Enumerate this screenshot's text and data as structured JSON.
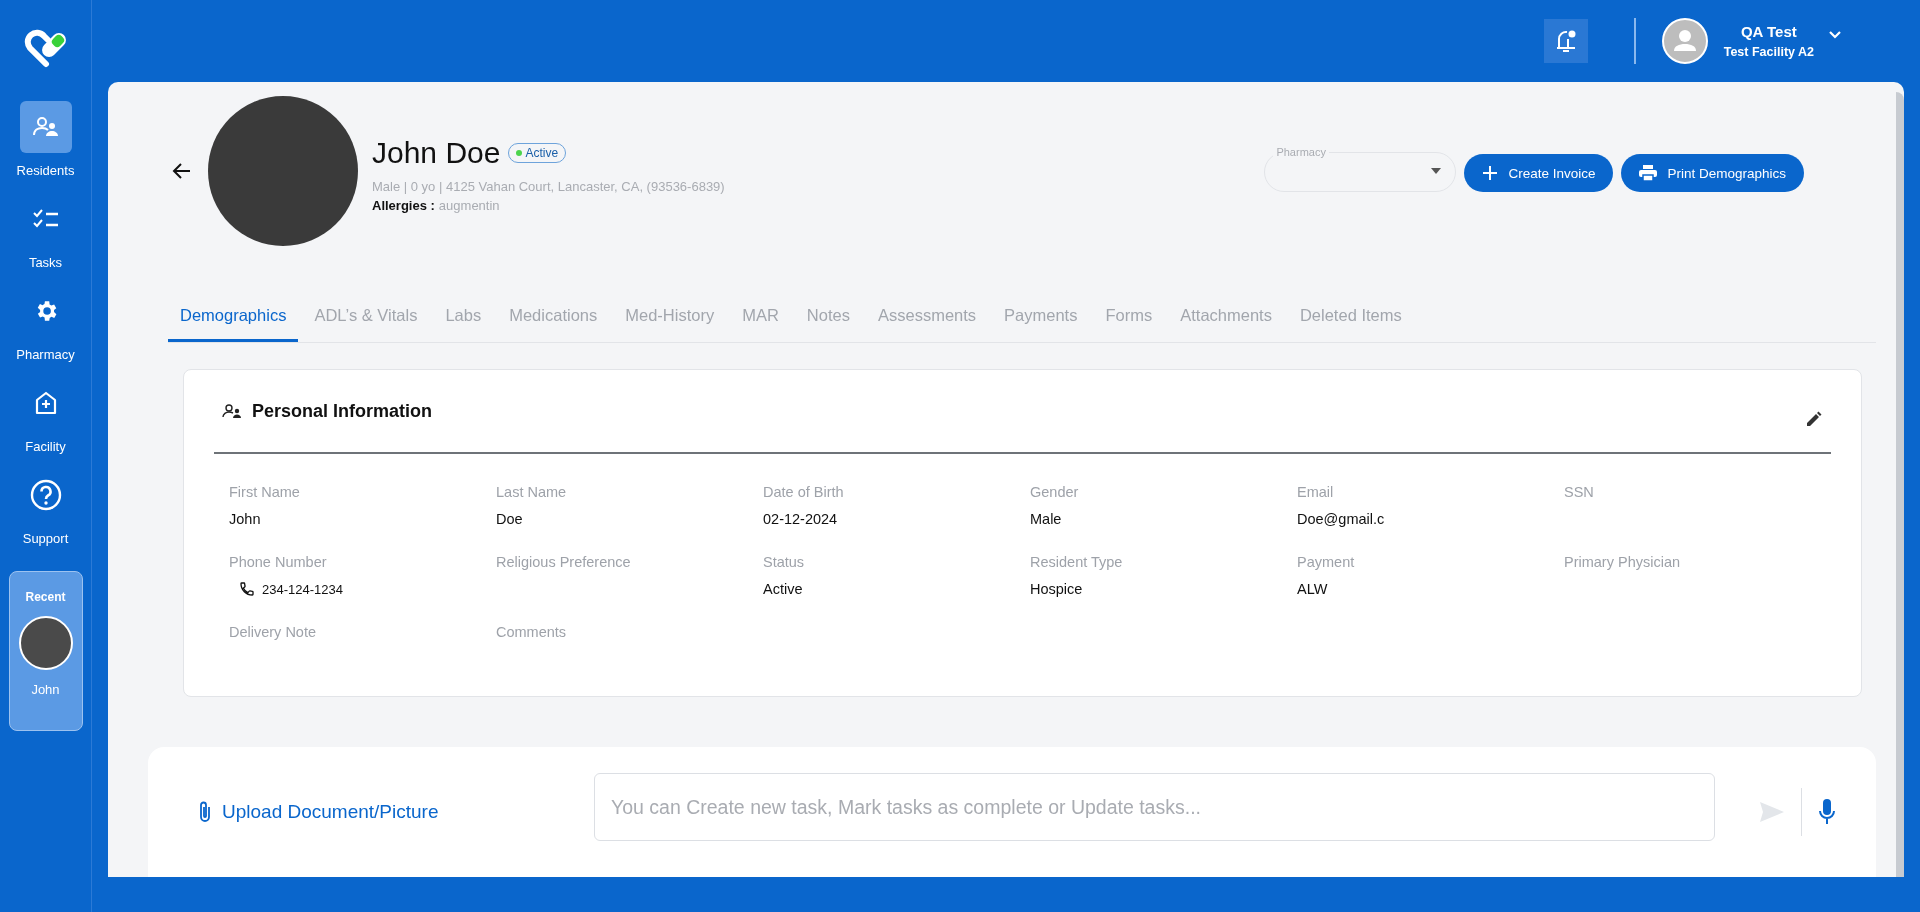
{
  "sidebar": {
    "items": [
      {
        "label": "Residents",
        "kind": "residents",
        "selected": true
      },
      {
        "label": "Tasks",
        "kind": "tasks",
        "selected": false
      },
      {
        "label": "Pharmacy",
        "kind": "settings",
        "selected": false
      },
      {
        "label": "Facility",
        "kind": "facility",
        "selected": false
      },
      {
        "label": "Support",
        "kind": "support",
        "selected": false
      }
    ],
    "recent": {
      "title": "Recent",
      "items": [
        {
          "name": "John"
        }
      ]
    }
  },
  "header": {
    "user": {
      "name": "QA Test",
      "facility": "Test Facility A2"
    }
  },
  "profile": {
    "name": "John Doe",
    "status": "Active",
    "details": "Male | 0 yo | 4125 Vahan Court, Lancaster, CA, (93536-6839)",
    "allergies_label": "Allergies :",
    "allergies": "augmentin"
  },
  "pharmacy_select": {
    "label": "Pharmacy"
  },
  "buttons": [
    {
      "label": "Create Invoice",
      "kind": "create"
    },
    {
      "label": "Print Demographics",
      "kind": "print"
    }
  ],
  "tabs": [
    {
      "label": "Demographics",
      "selected": true
    },
    {
      "label": "ADL’s & Vitals",
      "selected": false
    },
    {
      "label": "Labs",
      "selected": false
    },
    {
      "label": "Medications",
      "selected": false
    },
    {
      "label": "Med-History",
      "selected": false
    },
    {
      "label": "MAR",
      "selected": false
    },
    {
      "label": "Notes",
      "selected": false
    },
    {
      "label": "Assessments",
      "selected": false
    },
    {
      "label": "Payments",
      "selected": false
    },
    {
      "label": "Forms",
      "selected": false
    },
    {
      "label": "Attachments",
      "selected": false
    },
    {
      "label": "Deleted Items",
      "selected": false
    }
  ],
  "personal_information": {
    "title": "Personal Information",
    "fields": [
      {
        "label": "First Name",
        "value": "John"
      },
      {
        "label": "Last Name",
        "value": "Doe"
      },
      {
        "label": "Date of Birth",
        "value": "02-12-2024"
      },
      {
        "label": "Gender",
        "value": "Male"
      },
      {
        "label": "Email",
        "value": "Doe@gmail.c"
      },
      {
        "label": "SSN"
      },
      {
        "label": "Phone Number",
        "value": "234-124-1234",
        "kind": "phone"
      },
      {
        "label": "Religious Preference"
      },
      {
        "label": "Status",
        "value": "Active"
      },
      {
        "label": "Resident Type",
        "value": "Hospice"
      },
      {
        "label": "Payment",
        "value": "ALW"
      },
      {
        "label": "Primary Physician"
      },
      {
        "label": "Delivery Note"
      },
      {
        "label": "Comments"
      }
    ]
  },
  "composer": {
    "upload": "Upload Document/Picture",
    "placeholder": "You can Create new task, Mark tasks as complete or Update tasks..."
  }
}
